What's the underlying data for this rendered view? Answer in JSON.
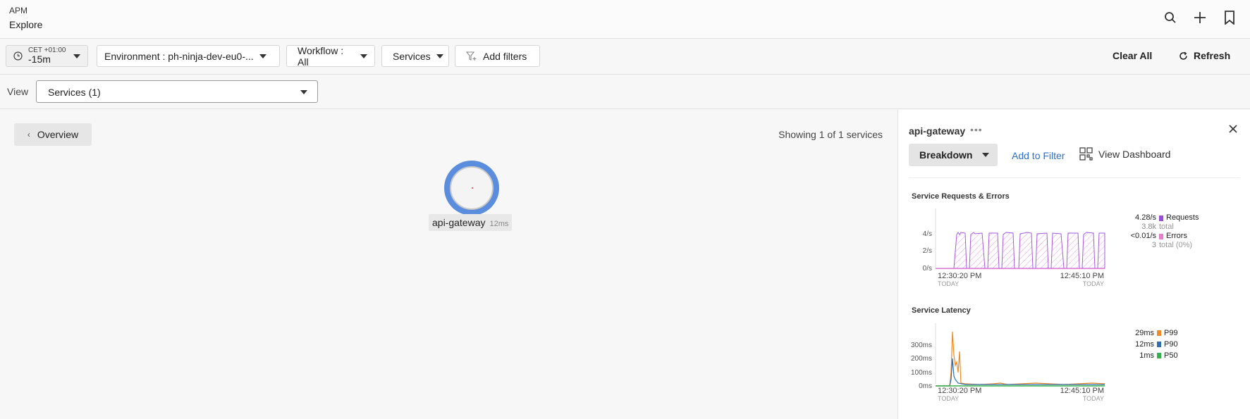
{
  "header": {
    "app": "APM",
    "title": "Explore"
  },
  "filters": {
    "time_tz": "CET +01:00",
    "time_range": "-15m",
    "environment": "Environment : ph-ninja-dev-eu0-...",
    "workflow": "Workflow : All",
    "services": "Services",
    "add_filters": "Add filters",
    "clear_all": "Clear All",
    "refresh": "Refresh"
  },
  "view": {
    "label": "View",
    "selected": "Services (1)"
  },
  "map": {
    "overview": "Overview",
    "showing": "Showing 1 of 1 services",
    "node": {
      "name": "api-gateway",
      "latency": "12ms"
    }
  },
  "panel": {
    "title": "api-gateway",
    "more": "•••",
    "breakdown": "Breakdown",
    "add_to_filter": "Add to Filter",
    "view_dashboard": "View Dashboard",
    "requests_chart": {
      "title": "Service Requests & Errors",
      "y_ticks": [
        "4/s",
        "2/s",
        "0/s"
      ],
      "x_start": "12:30:20 PM",
      "x_end": "12:45:10 PM",
      "x_start_sub": "TODAY",
      "x_end_sub": "TODAY",
      "legend": [
        {
          "value": "4.28/s",
          "name": "Requests",
          "sub_value": "3.8k",
          "sub_label": "total",
          "color": "#9b4ddb"
        },
        {
          "value": "<0.01/s",
          "name": "Errors",
          "sub_value": "3",
          "sub_label": "total (0%)",
          "color": "#e77fd0"
        }
      ]
    },
    "latency_chart": {
      "title": "Service Latency",
      "y_ticks": [
        "300ms",
        "200ms",
        "100ms",
        "0ms"
      ],
      "x_start": "12:30:20 PM",
      "x_end": "12:45:10 PM",
      "x_start_sub": "TODAY",
      "x_end_sub": "TODAY",
      "legend": [
        {
          "value": "29ms",
          "name": "P99",
          "color": "#f08a24"
        },
        {
          "value": "12ms",
          "name": "P90",
          "color": "#2f6fb0"
        },
        {
          "value": "1ms",
          "name": "P50",
          "color": "#33b24a"
        }
      ]
    }
  }
}
